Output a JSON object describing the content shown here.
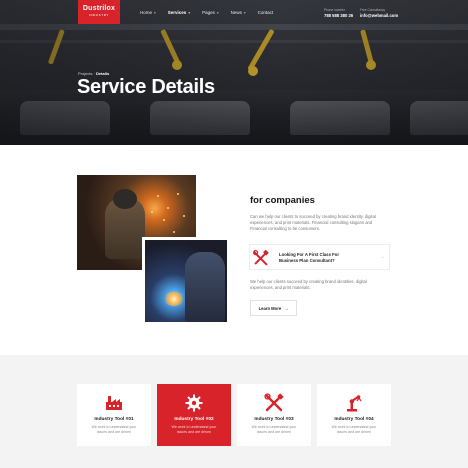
{
  "brand": {
    "name": "Dustrilox",
    "tagline": "INDUSTRY"
  },
  "nav": {
    "items": [
      {
        "label": "Home",
        "caret": "▾"
      },
      {
        "label": "Services",
        "caret": "▾"
      },
      {
        "label": "Pages",
        "caret": "▾"
      },
      {
        "label": "News",
        "caret": "▾"
      },
      {
        "label": "Contact",
        "caret": ""
      }
    ],
    "active": "Services"
  },
  "contact": {
    "phone_label": "Phone number",
    "phone": "788 588 380 26",
    "email_label": "Free Consultancy",
    "email": "info@webmail.com"
  },
  "breadcrumb": {
    "parent": "Projects",
    "separator": "·",
    "current": "Details"
  },
  "hero": {
    "title": "Service Details"
  },
  "about": {
    "title": "for companies",
    "text": "Can we help our clients to succeed by creating brand identity, digital experiences, and print materials. Financial consulting slogans and Financial consulting to be consumers.",
    "promo_title": "Looking For A First Class For Business Plan Consultant?",
    "promo_arrow": "→",
    "text2": "We help our clients succeed by creating brand identities, digital experiences, and print materials.",
    "button_label": "Learn More",
    "button_arrow": "→"
  },
  "services": [
    {
      "title": "Industry Tool #01",
      "desc": "We work to understand your issues and are driven",
      "icon": "factory-icon"
    },
    {
      "title": "Industry Tool #02",
      "desc": "We work to understand your issues and are driven",
      "icon": "gear-icon"
    },
    {
      "title": "Industry Tool #03",
      "desc": "We work to understand your issues and are driven",
      "icon": "tools-icon"
    },
    {
      "title": "Industry Tool #04",
      "desc": "We work to understand your issues and are driven",
      "icon": "robot-arm-icon"
    }
  ],
  "colors": {
    "accent": "#d8232a",
    "dark": "#1b1b1b",
    "muted": "#777777",
    "section_bg": "#f3f3f3"
  }
}
